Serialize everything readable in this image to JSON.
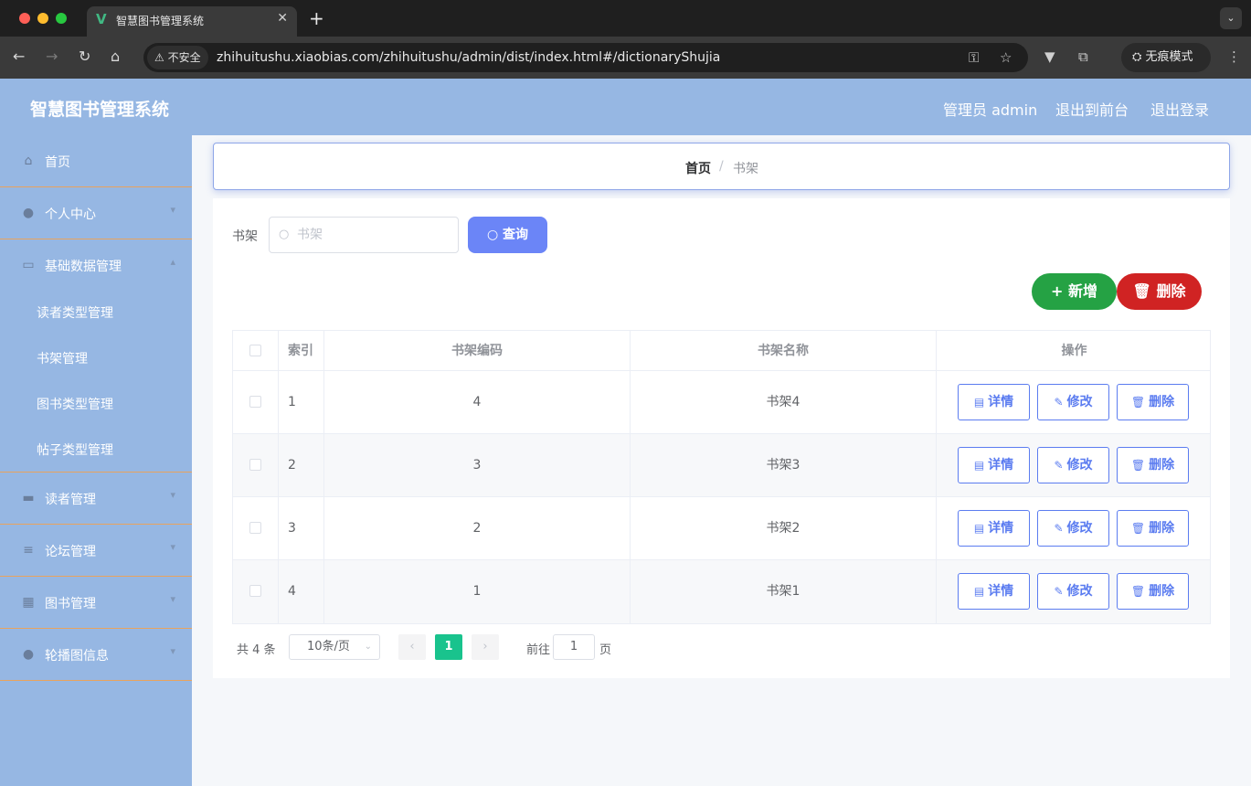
{
  "browser": {
    "tab_title": "智慧图书管理系统",
    "tab_logo": "V",
    "security_label": "不安全",
    "url": "zhihuitushu.xiaobias.com/zhihuitushu/admin/dist/index.html#/dictionaryShujia",
    "incognito_label": "无痕模式",
    "colors": {
      "chrome_dark": "#1f1f1f",
      "chrome_mid": "#3a3a3a"
    }
  },
  "header": {
    "title": "智慧图书管理系统",
    "user_label": "管理员 admin",
    "front_link": "退出到前台",
    "logout_link": "退出登录",
    "bg_color": "#96b7e3"
  },
  "sidebar": {
    "items": [
      {
        "label": "首页",
        "icon": "home-icon",
        "has_arrow": false
      },
      {
        "label": "个人中心",
        "icon": "user-icon",
        "has_arrow": true
      },
      {
        "label": "基础数据管理",
        "icon": "chat-icon",
        "has_arrow": true,
        "expanded": true
      },
      {
        "label": "读者管理",
        "icon": "briefcase-icon",
        "has_arrow": true
      },
      {
        "label": "论坛管理",
        "icon": "list-icon",
        "has_arrow": true
      },
      {
        "label": "图书管理",
        "icon": "grid-icon",
        "has_arrow": true
      },
      {
        "label": "轮播图信息",
        "icon": "bulb-icon",
        "has_arrow": true
      }
    ],
    "sub_items": [
      "读者类型管理",
      "书架管理",
      "图书类型管理",
      "帖子类型管理"
    ],
    "separator_color": "#e8a35e"
  },
  "breadcrumb": {
    "home": "首页",
    "separator": "/",
    "current": "书架"
  },
  "search": {
    "label": "书架",
    "placeholder": "书架",
    "value": "",
    "button_label": "查询",
    "button_color": "#6b85f7"
  },
  "actions": {
    "add_label": "新增",
    "delete_label": "删除",
    "add_color": "#25a244",
    "delete_color": "#d02323"
  },
  "table": {
    "columns": [
      "索引",
      "书架编码",
      "书架名称",
      "操作"
    ],
    "rows": [
      {
        "index": "1",
        "code": "4",
        "name": "书架4"
      },
      {
        "index": "2",
        "code": "3",
        "name": "书架3"
      },
      {
        "index": "3",
        "code": "2",
        "name": "书架2"
      },
      {
        "index": "4",
        "code": "1",
        "name": "书架1"
      }
    ],
    "row_actions": {
      "detail": "详情",
      "edit": "修改",
      "delete": "删除"
    },
    "action_color": "#5b7cf0"
  },
  "pagination": {
    "total_text": "共 4 条",
    "page_size": "10条/页",
    "current_page": "1",
    "goto_label": "前往",
    "goto_value": "1",
    "goto_suffix": "页",
    "active_color": "#19c38d"
  }
}
